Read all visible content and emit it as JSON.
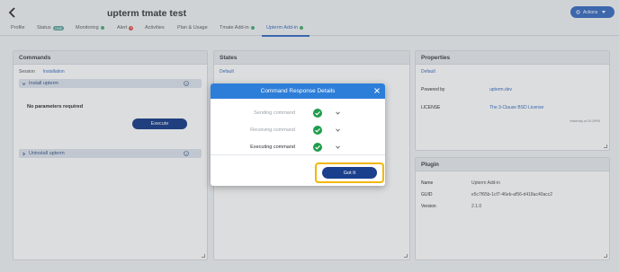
{
  "header": {
    "title": "upterm tmate test",
    "actions_label": "Actions"
  },
  "tabs": [
    {
      "label": "Profile"
    },
    {
      "label": "Status",
      "badge": "ONE"
    },
    {
      "label": "Monitoring"
    },
    {
      "label": "Alert",
      "badge": "0"
    },
    {
      "label": "Activities"
    },
    {
      "label": "Plan & Usage"
    },
    {
      "label": "Tmate Add-in"
    },
    {
      "label": "Upterm Add-in"
    }
  ],
  "commands": {
    "title": "Commands",
    "sub_tabs": [
      "Session",
      "Installation"
    ],
    "install_label": "Install upterm",
    "no_params": "No parameters required",
    "execute_label": "Execute",
    "uninstall_label": "Uninstall upterm"
  },
  "states": {
    "title": "States",
    "default_label": "Default"
  },
  "properties": {
    "title": "Properties",
    "default_label": "Default",
    "powered_by_key": "Powered by",
    "powered_by_val": "upterm.dev",
    "license_key": "LICENSE",
    "license_val": "The 3-Clause BSD License",
    "small_note": "Yesterday at 03:29PM"
  },
  "plugin": {
    "title": "Plugin",
    "name_key": "Name",
    "name_val": "Upterm Add-in",
    "guid_key": "GUID",
    "guid_val": "e5c7f65b-1cf7-46eb-af56-d418ac40acc2",
    "version_key": "Version",
    "version_val": "2.1.0"
  },
  "modal": {
    "title": "Command Response Details",
    "steps": [
      {
        "label": "Sending command",
        "state": "done"
      },
      {
        "label": "Receiving command",
        "state": "done"
      },
      {
        "label": "Executing command",
        "state": "current"
      }
    ],
    "confirm_label": "Got It"
  },
  "colors": {
    "accent": "#2d7ed9",
    "primary_button": "#1a3f8c",
    "highlight": "#f2b705",
    "success": "#1f9d4c"
  }
}
